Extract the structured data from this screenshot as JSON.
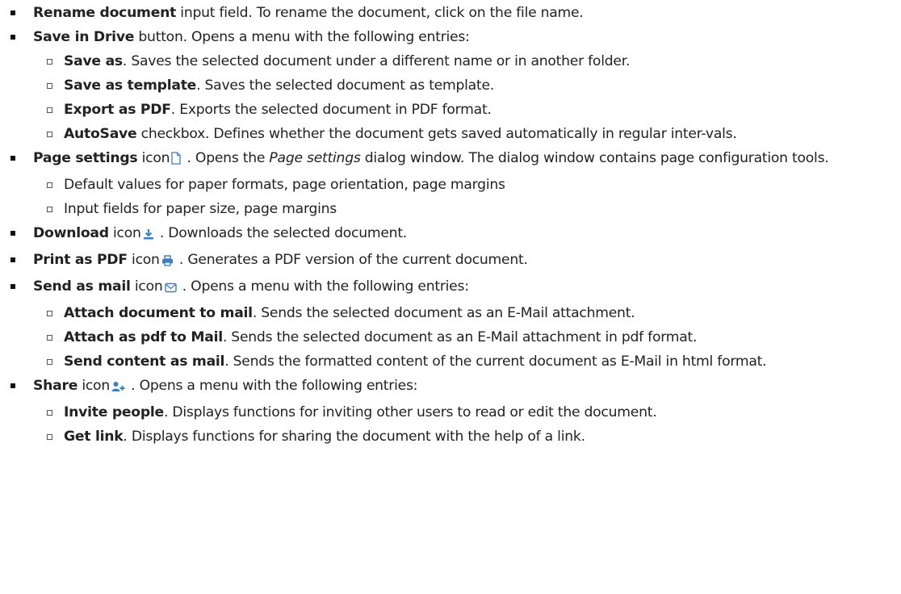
{
  "items": [
    {
      "level": 1,
      "bold": "Rename document",
      "rest": " input field. To rename the document, click on the file name."
    },
    {
      "level": 1,
      "bold": "Save in Drive",
      "rest": " button. Opens a menu with the following entries:"
    },
    {
      "level": 2,
      "bold": "Save as",
      "rest": ". Saves the selected document under a different name or in another folder."
    },
    {
      "level": 2,
      "bold": "Save as template",
      "rest": ". Saves the selected document as template."
    },
    {
      "level": 2,
      "bold": "Export as PDF",
      "rest": ". Exports the selected document in PDF format."
    },
    {
      "level": 2,
      "bold": "AutoSave",
      "rest": " checkbox. Defines whether the document gets saved automatically in regular inter-vals."
    },
    {
      "level": 1,
      "bold": "Page settings",
      "word": " icon",
      "icon": "page-icon",
      "after_icon": " . Opens the ",
      "italic": "Page settings",
      "rest": " dialog window. The dialog window contains page configuration tools."
    },
    {
      "level": 2,
      "bold": "",
      "rest": "Default values for paper formats, page orientation, page margins"
    },
    {
      "level": 2,
      "bold": "",
      "rest": "Input fields for paper size, page margins"
    },
    {
      "level": 1,
      "bold": "Download",
      "word": " icon",
      "icon": "download-icon",
      "after_icon": " . Downloads the selected document.",
      "italic": "",
      "rest": ""
    },
    {
      "level": 1,
      "bold": "Print as PDF",
      "word": " icon",
      "icon": "print-icon",
      "after_icon": " . Generates a PDF version of the current document.",
      "italic": "",
      "rest": ""
    },
    {
      "level": 1,
      "bold": "Send as mail",
      "word": " icon",
      "icon": "mail-icon",
      "after_icon": " . Opens a menu with the following entries:",
      "italic": "",
      "rest": ""
    },
    {
      "level": 2,
      "bold": "Attach document to mail",
      "rest": ". Sends the selected document as an E-Mail attachment."
    },
    {
      "level": 2,
      "bold": "Attach as pdf to Mail",
      "rest": ". Sends the selected document as an E-Mail attachment in pdf format."
    },
    {
      "level": 2,
      "bold": "Send content as mail",
      "rest": ". Sends the formatted content of the current document as E-Mail in html format."
    },
    {
      "level": 1,
      "bold": "Share",
      "word": " icon",
      "icon": "share-user-icon",
      "after_icon": " . Opens a menu with the following entries:",
      "italic": "",
      "rest": ""
    },
    {
      "level": 2,
      "bold": "Invite people",
      "rest": ". Displays functions for inviting other users to read or edit the document."
    },
    {
      "level": 2,
      "bold": "Get link",
      "rest": ". Displays functions for sharing the document with the help of a link."
    }
  ],
  "colors": {
    "text": "#222222",
    "icon": "#3b7fc4"
  }
}
